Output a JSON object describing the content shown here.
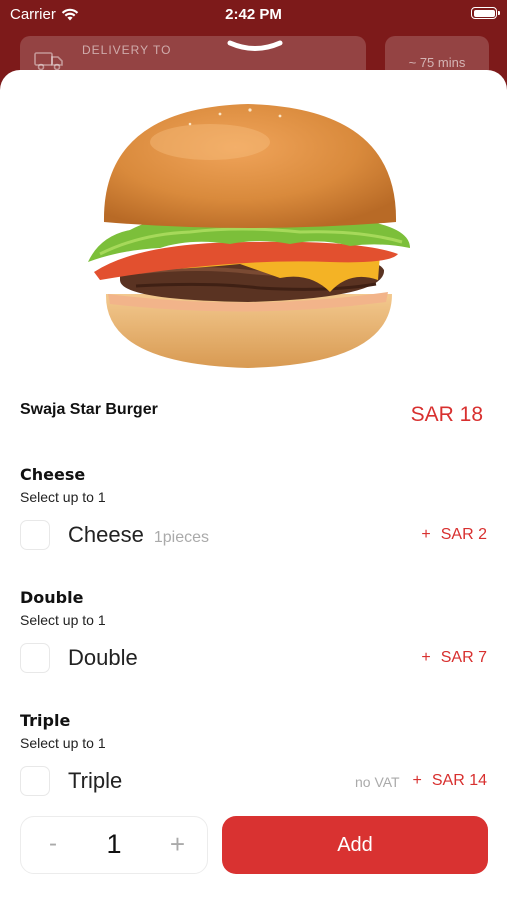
{
  "status_bar": {
    "carrier": "Carrier",
    "time": "2:42 PM"
  },
  "header": {
    "delivery_label": "DELIVERY TO",
    "delivery_time": "~ 75 mins"
  },
  "product": {
    "name": "Swaja Star Burger",
    "price": "SAR 18",
    "image_icon": "burger-image"
  },
  "option_groups": [
    {
      "title": "Cheese",
      "subtitle": "Select up to 1",
      "option": {
        "name": "Cheese",
        "note": "1pieces",
        "plus": "+",
        "price": "SAR 2",
        "vat": ""
      }
    },
    {
      "title": "Double",
      "subtitle": "Select up to 1",
      "option": {
        "name": "Double",
        "note": "",
        "plus": "+",
        "price": "SAR 7",
        "vat": ""
      }
    },
    {
      "title": "Triple",
      "subtitle": "Select up to 1",
      "option": {
        "name": "Triple",
        "note": "",
        "plus": "+",
        "price": "SAR 14",
        "vat": "no VAT"
      }
    }
  ],
  "quantity": {
    "minus": "-",
    "value": "1",
    "plus": "+"
  },
  "add_button": {
    "label": "Add"
  },
  "colors": {
    "brand": "#d93231",
    "header_bg": "#7d1a1a"
  }
}
